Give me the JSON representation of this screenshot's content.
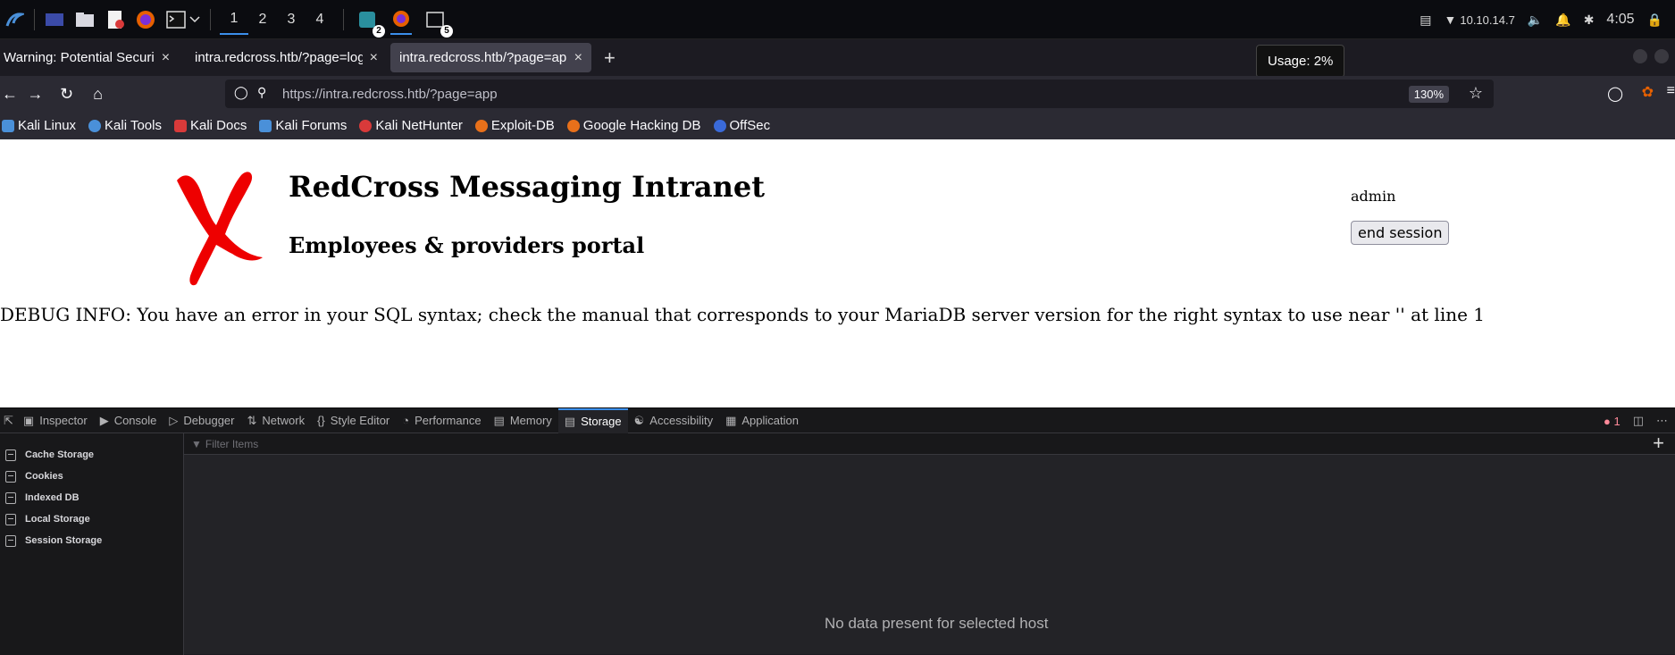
{
  "taskbar": {
    "workspaces": [
      "1",
      "2",
      "3",
      "4"
    ],
    "badges": {
      "terminal_count": "2",
      "window_count": "5"
    },
    "ip_address": "10.10.14.7",
    "clock": "4:05"
  },
  "tabs": [
    {
      "label": "Warning: Potential Securi",
      "active": false
    },
    {
      "label": "intra.redcross.htb/?page=log",
      "active": false
    },
    {
      "label": "intra.redcross.htb/?page=app",
      "active": true
    }
  ],
  "tooltip": "Usage: 2%",
  "navbar": {
    "url": "https://intra.redcross.htb/?page=app",
    "zoom": "130%"
  },
  "bookmarks": [
    {
      "label": "Kali Linux",
      "color": "#4a90d9"
    },
    {
      "label": "Kali Tools",
      "color": "#4a90d9"
    },
    {
      "label": "Kali Docs",
      "color": "#d93a3a"
    },
    {
      "label": "Kali Forums",
      "color": "#4a90d9"
    },
    {
      "label": "Kali NetHunter",
      "color": "#d93a3a"
    },
    {
      "label": "Exploit-DB",
      "color": "#e8701a"
    },
    {
      "label": "Google Hacking DB",
      "color": "#e8701a"
    },
    {
      "label": "OffSec",
      "color": "#3a6ad9"
    }
  ],
  "page": {
    "title": "RedCross Messaging Intranet",
    "subtitle": "Employees & providers portal",
    "username": "admin",
    "end_session": "end session",
    "debug": "DEBUG INFO: You have an error in your SQL syntax; check the manual that corresponds to your MariaDB server version for the right syntax to use near '' at line 1"
  },
  "devtools": {
    "tabs": [
      "Inspector",
      "Console",
      "Debugger",
      "Network",
      "Style Editor",
      "Performance",
      "Memory",
      "Storage",
      "Accessibility",
      "Application"
    ],
    "active_tab": "Storage",
    "error_count": "1",
    "filter_placeholder": "Filter Items",
    "sidebar": [
      "Cache Storage",
      "Cookies",
      "Indexed DB",
      "Local Storage",
      "Session Storage"
    ],
    "empty_message": "No data present for selected host"
  }
}
